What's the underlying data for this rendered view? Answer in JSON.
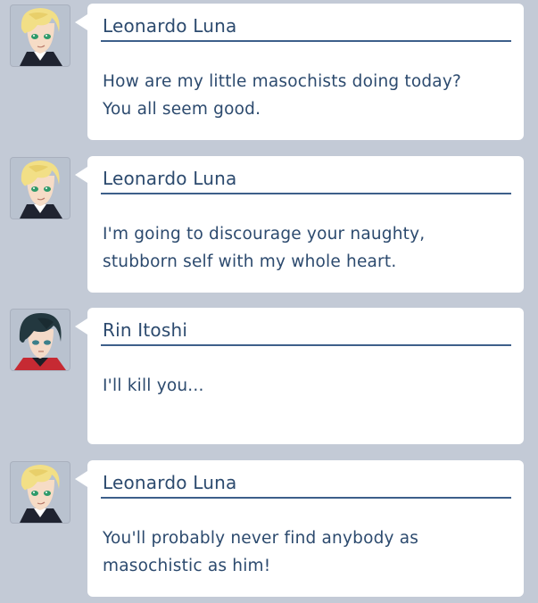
{
  "messages": [
    {
      "speaker": "Leonardo Luna",
      "avatar": "blonde-character-avatar",
      "text": "How are my little masochists doing today?\nYou all seem good."
    },
    {
      "speaker": "Leonardo Luna",
      "avatar": "blonde-character-avatar",
      "text": "I'm going to discourage your naughty,\nstubborn self with my whole heart."
    },
    {
      "speaker": "Rin Itoshi",
      "avatar": "dark-haired-character-avatar",
      "text": "I'll kill you..."
    },
    {
      "speaker": "Leonardo Luna",
      "avatar": "blonde-character-avatar",
      "text": "You'll probably never find anybody as\nmasochistic as him!"
    }
  ],
  "colors": {
    "background": "#c3cad6",
    "bubble": "#ffffff",
    "text": "#2c4a6e",
    "name_rule": "#3d5f8a"
  }
}
